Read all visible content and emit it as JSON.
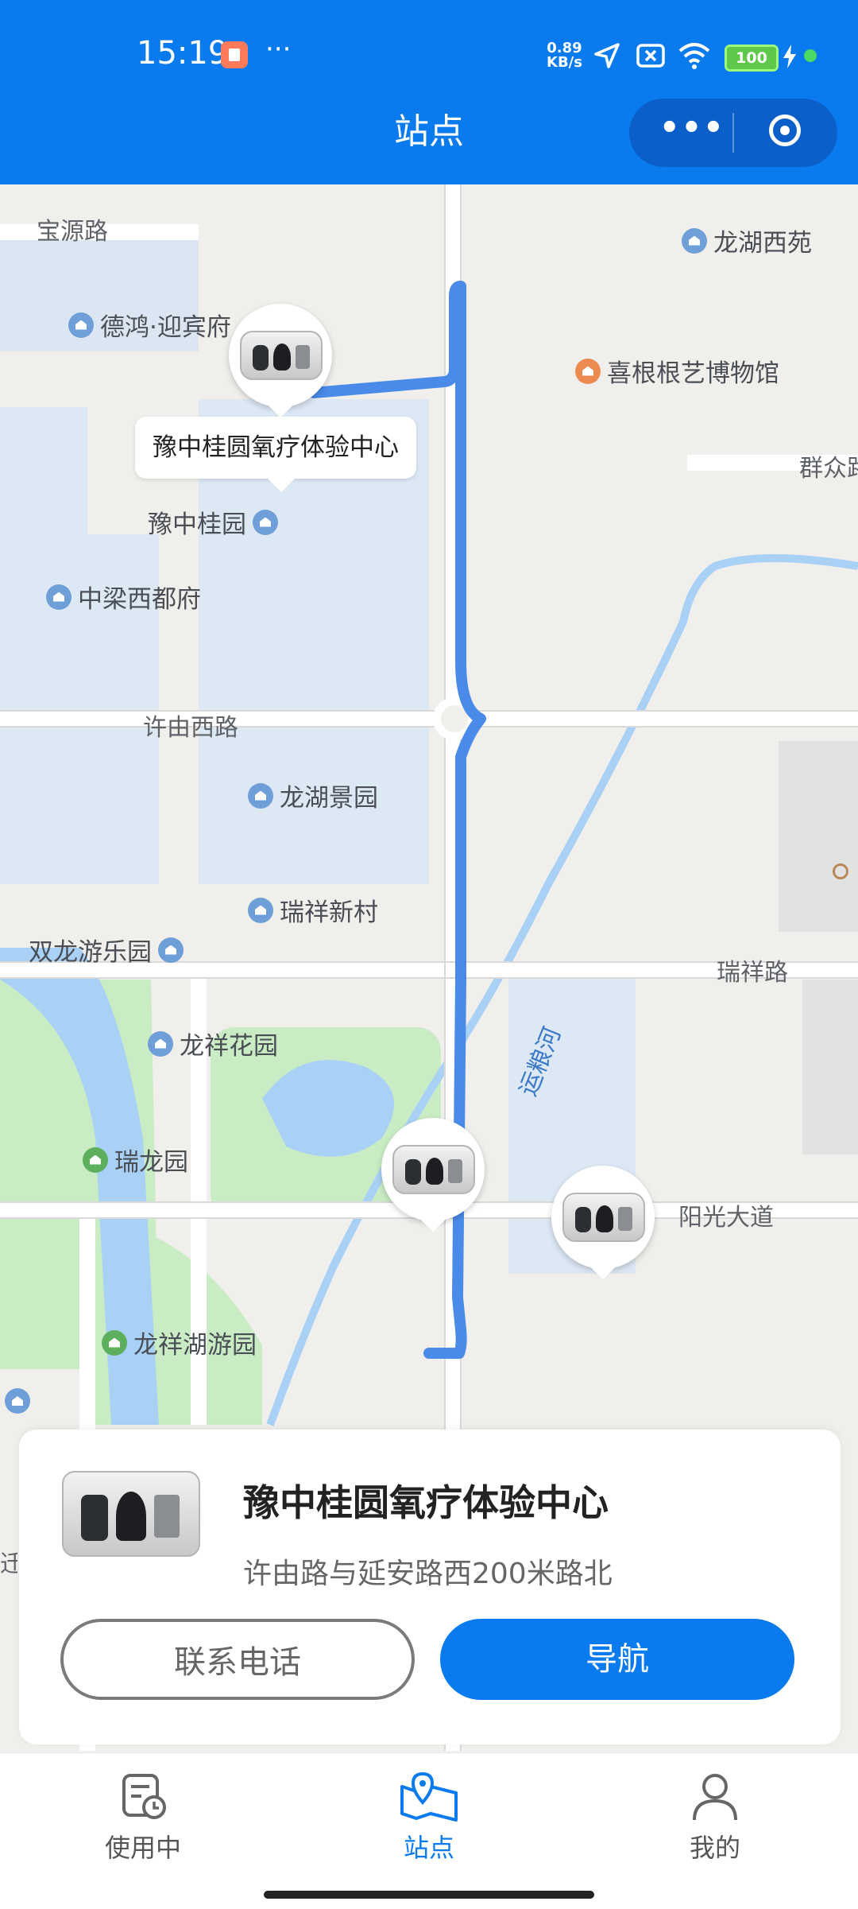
{
  "status_bar": {
    "time": "15:19",
    "net_speed_value": "0.89",
    "net_speed_unit": "KB/s",
    "battery": "100"
  },
  "header": {
    "title": "站点",
    "more_icon": "more-dots-icon",
    "close_icon": "target-icon"
  },
  "map": {
    "callout": "豫中桂圆氧疗体验中心",
    "roads": {
      "baoyuan": "宝源路",
      "xuyou_west": "许由西路",
      "ruixiang": "瑞祥路",
      "yangguang": "阳光大道",
      "qunzhong": "群众路",
      "river": "运粮河"
    },
    "pois": {
      "longhu_xiyuan": "龙湖西苑",
      "dehong": "德鸿·迎宾府",
      "xigengen": "喜根根艺博物馆",
      "yuzhong_guiyuan": "豫中桂园",
      "zhongliang": "中梁西都府",
      "longhu_jingyuan": "龙湖景园",
      "ruixiang_xincun": "瑞祥新村",
      "shuanglong": "双龙游乐园",
      "longxiang_huayuan": "龙祥花园",
      "ruilong": "瑞龙园",
      "longxiang_lake": "龙祥湖游园",
      "partial_edge": "迁"
    }
  },
  "station_card": {
    "name": "豫中桂圆氧疗体验中心",
    "address": "许由路与延安路西200米路北",
    "call_button": "联系电话",
    "nav_button": "导航"
  },
  "tabbar": {
    "tabs": [
      {
        "label": "使用中",
        "icon": "receipt-clock-icon"
      },
      {
        "label": "站点",
        "icon": "map-pin-icon",
        "active": true
      },
      {
        "label": "我的",
        "icon": "person-icon"
      }
    ]
  },
  "colors": {
    "primary": "#0a7bef",
    "route": "#4a8bea",
    "water": "#a9d0f5",
    "park": "#c9ecc4"
  }
}
